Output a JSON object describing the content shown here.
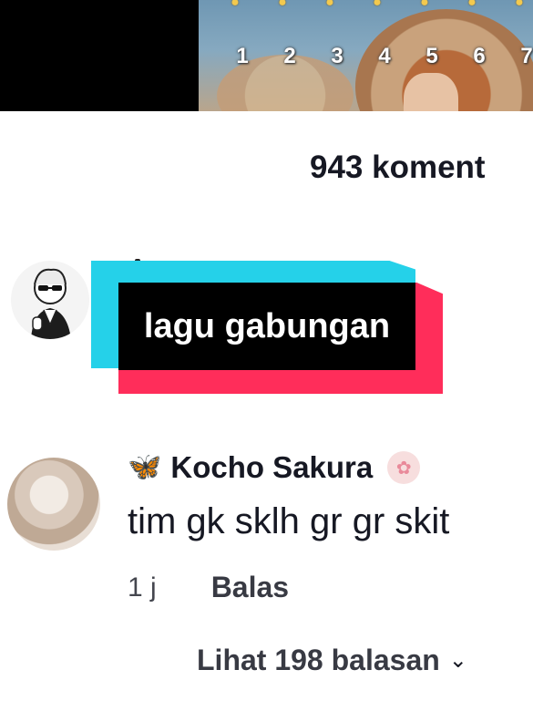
{
  "video_strip": {
    "numbers": [
      "1",
      "2",
      "3",
      "4",
      "5",
      "6",
      "7"
    ],
    "icons": [
      "emoji-icon",
      "emoji-icon",
      "emoji-icon",
      "emoji-icon",
      "emoji-icon",
      "emoji-icon",
      "emoji-icon"
    ]
  },
  "comments_header": {
    "count_label": "943 koment"
  },
  "overlay": {
    "sticker_text": "lagu gabungan",
    "colors": {
      "cyan": "#25d1e9",
      "red": "#ff2d5a",
      "black": "#000000"
    }
  },
  "comment": {
    "author": "Kocho Sakura",
    "author_prefix_icon": "butterfly-icon",
    "author_suffix_icon": "flower-badge-icon",
    "text": "tim gk sklh gr gr skit",
    "time": "1 j",
    "reply_label": "Balas",
    "view_replies_label": "Lihat 198 balasan"
  }
}
